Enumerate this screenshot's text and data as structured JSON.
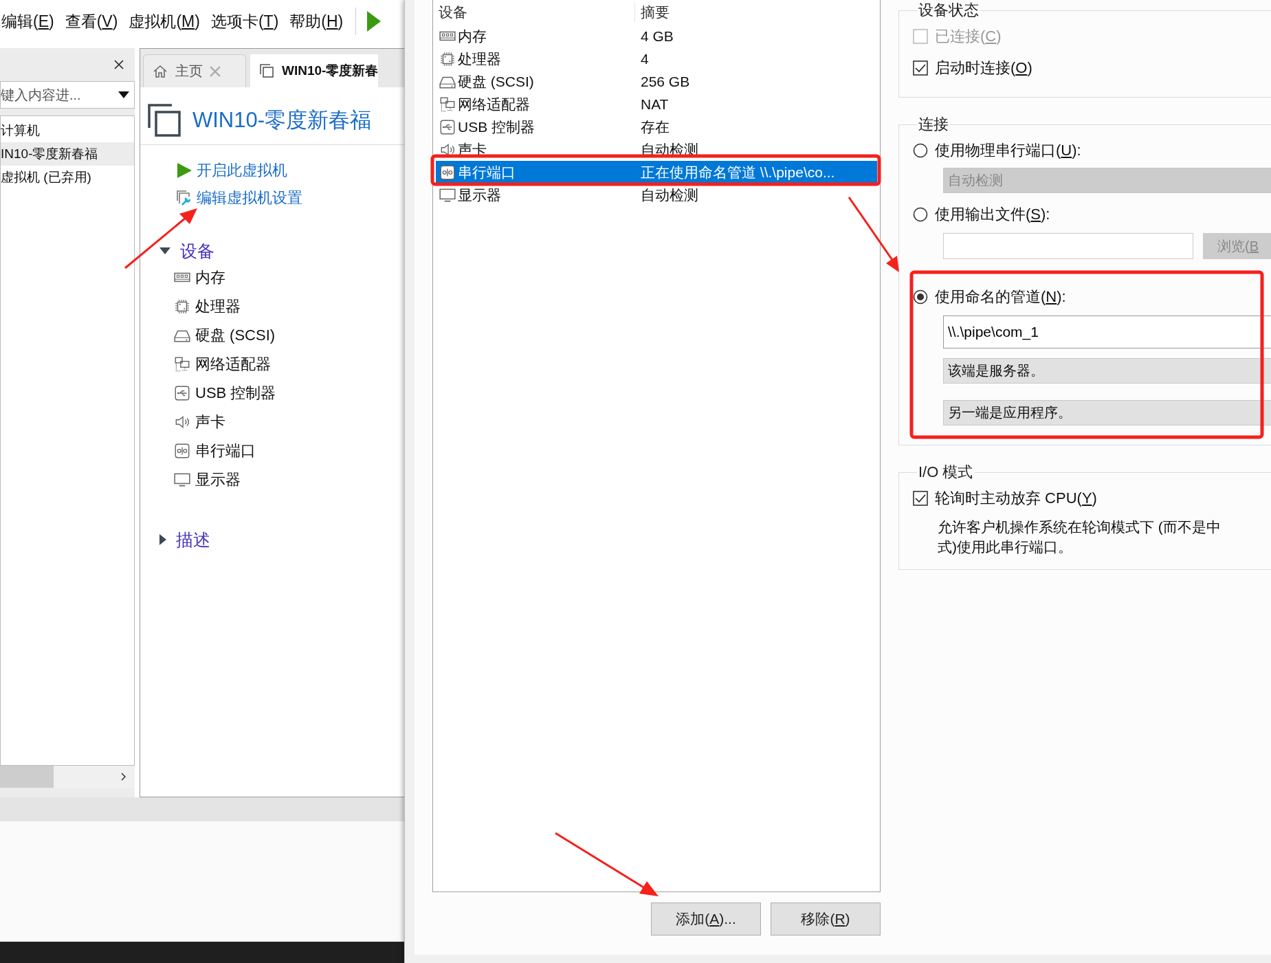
{
  "menu_bar": {
    "items": [
      {
        "label": [
          "编辑(",
          "E",
          ")"
        ]
      },
      {
        "label": [
          "查看(",
          "V",
          ")"
        ]
      },
      {
        "label": [
          "虚拟机(",
          "M",
          ")"
        ]
      },
      {
        "label": [
          "选项卡(",
          "T",
          ")"
        ]
      },
      {
        "label": [
          "帮助(",
          "H",
          ")"
        ]
      }
    ]
  },
  "library": {
    "search": {
      "placeholder": "键入内容进..."
    },
    "tree": [
      {
        "label": "计算机",
        "selected": false
      },
      {
        "label": "IN10-零度新春福",
        "selected": true
      },
      {
        "label": "虚拟机 (已弃用)",
        "selected": false
      }
    ]
  },
  "tabs": [
    {
      "kind": "home",
      "label": "主页",
      "selected": false
    },
    {
      "kind": "vm",
      "label": "WIN10-零度新春",
      "selected": true
    }
  ],
  "vm_page": {
    "title": "WIN10-零度新春福",
    "actions": [
      {
        "kind": "power-on",
        "label": "开启此虚拟机"
      },
      {
        "kind": "edit",
        "label": "编辑虚拟机设置"
      }
    ],
    "sections": [
      {
        "title": "设备",
        "expanded": true,
        "devices": [
          {
            "kind": "memory",
            "name": "内存"
          },
          {
            "kind": "cpu",
            "name": "处理器"
          },
          {
            "kind": "disk",
            "name": "硬盘 (SCSI)"
          },
          {
            "kind": "network",
            "name": "网络适配器"
          },
          {
            "kind": "usb",
            "name": "USB 控制器"
          },
          {
            "kind": "sound",
            "name": "声卡"
          },
          {
            "kind": "serial",
            "name": "串行端口"
          },
          {
            "kind": "display",
            "name": "显示器"
          }
        ]
      },
      {
        "title": "描述",
        "expanded": false
      }
    ]
  },
  "dialog": {
    "hardware_table": {
      "columns": [
        "设备",
        "摘要"
      ],
      "rows": [
        {
          "kind": "memory",
          "device": "内存",
          "summary": "4 GB",
          "selected": false
        },
        {
          "kind": "cpu",
          "device": "处理器",
          "summary": "4",
          "selected": false
        },
        {
          "kind": "disk",
          "device": "硬盘 (SCSI)",
          "summary": "256 GB",
          "selected": false
        },
        {
          "kind": "network",
          "device": "网络适配器",
          "summary": "NAT",
          "selected": false
        },
        {
          "kind": "usb",
          "device": "USB 控制器",
          "summary": "存在",
          "selected": false
        },
        {
          "kind": "sound",
          "device": "声卡",
          "summary": "自动检测",
          "selected": false
        },
        {
          "kind": "serial",
          "device": "串行端口",
          "summary": "正在使用命名管道 \\\\.\\pipe\\co...",
          "selected": true
        },
        {
          "kind": "display",
          "device": "显示器",
          "summary": "自动检测",
          "selected": false
        }
      ]
    },
    "buttons": [
      {
        "label": [
          "添加(",
          "A",
          ")..."
        ]
      },
      {
        "label": [
          "移除(",
          "R",
          ")"
        ]
      }
    ],
    "device_status": {
      "title": "设备状态",
      "options": [
        {
          "label": [
            "已连接(",
            "C",
            ")"
          ],
          "checked": false,
          "disabled": true
        },
        {
          "label": [
            "启动时连接(",
            "O",
            ")"
          ],
          "checked": true,
          "disabled": false
        }
      ]
    },
    "connection": {
      "title": "连接",
      "physical": {
        "label": [
          "使用物理串行端口(",
          "U",
          "):"
        ],
        "selected": false,
        "port": "自动检测"
      },
      "file": {
        "label": [
          "使用输出文件(",
          "S",
          "):"
        ],
        "selected": false,
        "browse_button": [
          "浏览(",
          "B"
        ]
      },
      "pipe": {
        "label": [
          "使用命名的管道(",
          "N",
          "):"
        ],
        "selected": true,
        "path": "\\\\.\\pipe\\com_1",
        "this_end": "该端是服务器。",
        "other_end": "另一端是应用程序。"
      }
    },
    "io_mode": {
      "title": "I/O 模式",
      "option": {
        "label": [
          "轮询时主动放弃 CPU(",
          "Y",
          ")"
        ],
        "checked": true
      },
      "description_lines": [
        "允许客户机操作系统在轮询模式下 (而不是中",
        "式)使用此串行端口。"
      ]
    }
  }
}
